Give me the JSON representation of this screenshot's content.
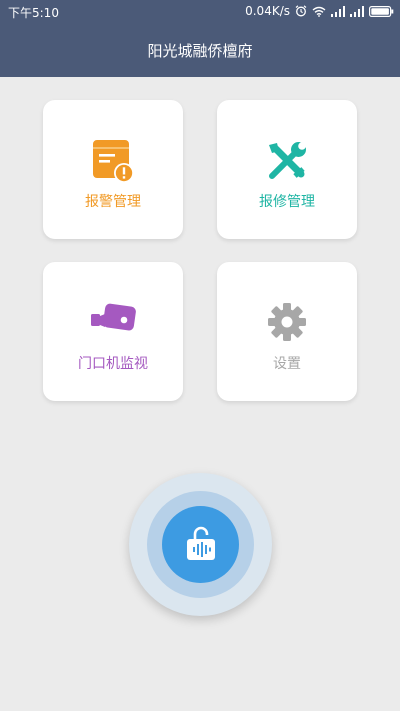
{
  "status_bar": {
    "time": "下午5:10",
    "network_speed": "0.04K/s"
  },
  "header": {
    "title": "阳光城融侨檀府"
  },
  "menu": [
    {
      "label": "报警管理",
      "icon": "alarm-document-icon",
      "color": "#f19a26"
    },
    {
      "label": "报修管理",
      "icon": "repair-tools-icon",
      "color": "#1fb5a4"
    },
    {
      "label": "门口机监视",
      "icon": "video-camera-icon",
      "color": "#a559c0"
    },
    {
      "label": "设置",
      "icon": "gear-icon",
      "color": "#a7a7a7"
    }
  ],
  "unlock": {
    "icon": "unlock-icon",
    "color": "#3d9be2"
  }
}
